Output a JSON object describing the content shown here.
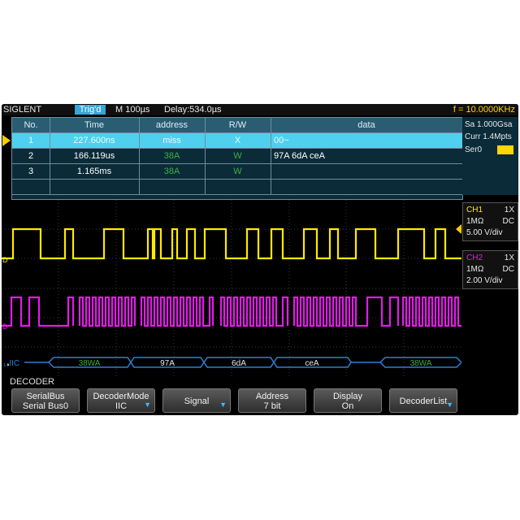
{
  "topbar": {
    "brand": "SIGLENT",
    "trigger_status": "Trig'd",
    "timebase": "M 100µs",
    "delay": "Delay:534.0µs",
    "frequency": "f = 10.0000KHz"
  },
  "decode_table": {
    "headers": [
      "No.",
      "Time",
      "address",
      "R/W",
      "data"
    ],
    "rows": [
      {
        "no": "1",
        "time": "227.600ns",
        "address": "miss",
        "rw": "X",
        "data": "00~"
      },
      {
        "no": "2",
        "time": "166.119us",
        "address": "38A",
        "rw": "W",
        "data": "97A  6dA  ceA"
      },
      {
        "no": "3",
        "time": "1.165ms",
        "address": "38A",
        "rw": "W",
        "data": ""
      }
    ]
  },
  "side_panel": {
    "sample_rate": "Sa 1.000Gsa",
    "memory": "Curr 1.4Mpts",
    "serial_label": "Ser0"
  },
  "ch1": {
    "name": "CH1",
    "probe": "1X",
    "impedance": "1MΩ",
    "coupling": "DC",
    "scale": "5.00 V/div"
  },
  "ch2": {
    "name": "CH2",
    "probe": "1X",
    "impedance": "1MΩ",
    "coupling": "DC",
    "scale": "2.00 V/div"
  },
  "bus": {
    "label": "₁₂IIC",
    "segments": [
      "38WA",
      "97A",
      "6dA",
      "ceA",
      "38WA"
    ]
  },
  "menu": {
    "title": "DECODER",
    "softkeys": [
      {
        "line1": "SerialBus",
        "line2": "Serial Bus0"
      },
      {
        "line1": "DecoderMode",
        "line2": "IIC"
      },
      {
        "line1": "Signal",
        "line2": ""
      },
      {
        "line1": "Address",
        "line2": "7 bit"
      },
      {
        "line1": "Display",
        "line2": "On"
      },
      {
        "line1": "DecoderList",
        "line2": ""
      }
    ]
  },
  "colors": {
    "ch1": "#ffea00",
    "ch2": "#e21be6",
    "bus": "#2f7fd6",
    "accent": "#37a6d8",
    "selected_row": "#4ed0ee"
  }
}
